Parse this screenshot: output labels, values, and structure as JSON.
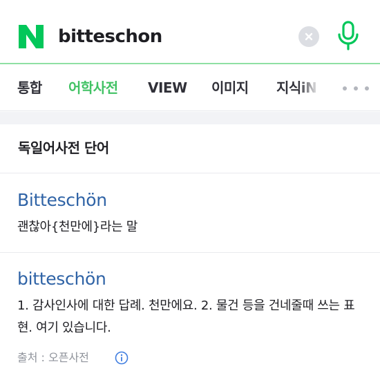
{
  "search": {
    "logo_letter": "N",
    "query": "bitteschon"
  },
  "tabs": [
    {
      "label": "통합",
      "active": false
    },
    {
      "label": "어학사전",
      "active": true
    },
    {
      "label": "VIEW",
      "active": false
    },
    {
      "label": "이미지",
      "active": false
    },
    {
      "label": "지식iN",
      "active": false
    }
  ],
  "section": {
    "title": "독일어사전 단어"
  },
  "entries": [
    {
      "word": "Bitteschön",
      "definition": "괜찮아{천만에}라는 말"
    },
    {
      "word": "bitteschön",
      "definition": "1. 감사인사에 대한 답례. 천만에요. 2. 물건 등을 건네줄때 쓰는 표현. 여기 있습니다."
    }
  ],
  "source": {
    "label": "출처 : 오픈사전"
  },
  "icons": {
    "logo": "naver-logo-icon",
    "clear": "clear-icon",
    "mic": "microphone-icon",
    "more": "more-dots-icon",
    "info": "info-icon"
  },
  "colors": {
    "brand": "#03c75a",
    "active_tab": "#41c264",
    "link": "#2f63a6",
    "search_border": "#8ee0a3"
  }
}
